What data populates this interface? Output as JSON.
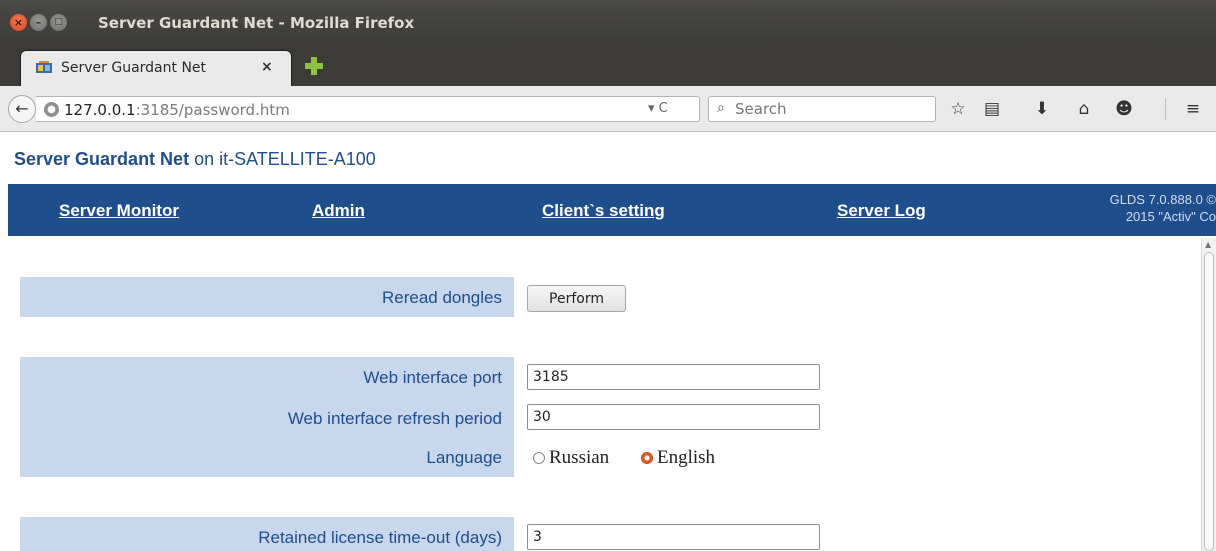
{
  "window": {
    "title": "Server Guardant Net - Mozilla Firefox",
    "controls": {
      "close": "×",
      "minimize": "–",
      "maximize": "□"
    }
  },
  "tab": {
    "title": "Server Guardant Net",
    "close": "×"
  },
  "navbar": {
    "url_host": "127.0.0.1",
    "url_rest": ":3185/password.htm",
    "url_controls": "▾ C",
    "search_placeholder": "Search",
    "icons": [
      "bookmark-star-icon",
      "reading-list-icon",
      "download-icon",
      "home-icon",
      "chat-icon",
      "menu-icon"
    ]
  },
  "page": {
    "app_name": "Server Guardant Net",
    "host_text": " on it-SATELLITE-A100",
    "menu": [
      "Server Monitor",
      "Admin",
      "Client`s setting",
      "Server Log"
    ],
    "version_line1": "GLDS 7.0.888.0 ©",
    "version_line2": "2015 \"Activ\" Co",
    "settings": {
      "reread_label": "Reread dongles",
      "perform_button": "Perform",
      "web_port_label": "Web interface port",
      "web_port_value": "3185",
      "refresh_label": "Web interface refresh period",
      "refresh_value": "30",
      "language_label": "Language",
      "language_options": [
        "Russian",
        "English"
      ],
      "language_selected": "English",
      "retained_label": "Retained license time-out (days)",
      "retained_value": "3"
    }
  },
  "colors": {
    "brand": "#1f4e8c",
    "row_background": "#c8d6ee",
    "titlebar": "#3c3b37"
  }
}
